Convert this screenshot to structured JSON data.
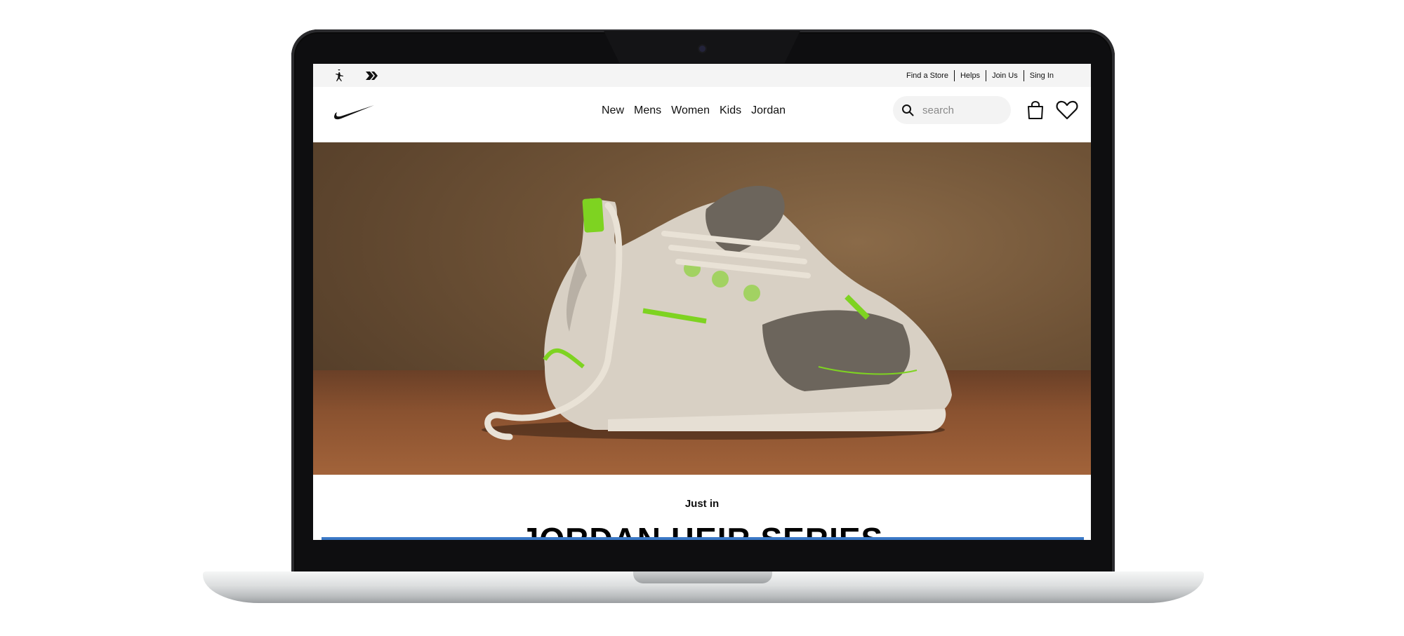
{
  "topbar": {
    "brand_icons": [
      "jordan-jumpman-icon",
      "converse-icon"
    ],
    "links": [
      "Find a Store",
      "Helps",
      "Join Us",
      "Sing In"
    ]
  },
  "navbar": {
    "logo": "nike-swoosh-icon",
    "menu": [
      "New",
      "Mens",
      "Women",
      "Kids",
      "Jordan"
    ],
    "search_placeholder": "search",
    "icons": [
      "search-icon",
      "bag-icon",
      "heart-icon"
    ]
  },
  "hero": {
    "image": "basketball sneaker on wooden floor",
    "accent_color": "#7ed321"
  },
  "section": {
    "eyebrow": "Just in",
    "headline": "JORDAN HEIR SERIES"
  },
  "colors": {
    "topbar_bg": "#f4f4f4",
    "search_bg": "#f3f3f3",
    "text": "#111111"
  }
}
